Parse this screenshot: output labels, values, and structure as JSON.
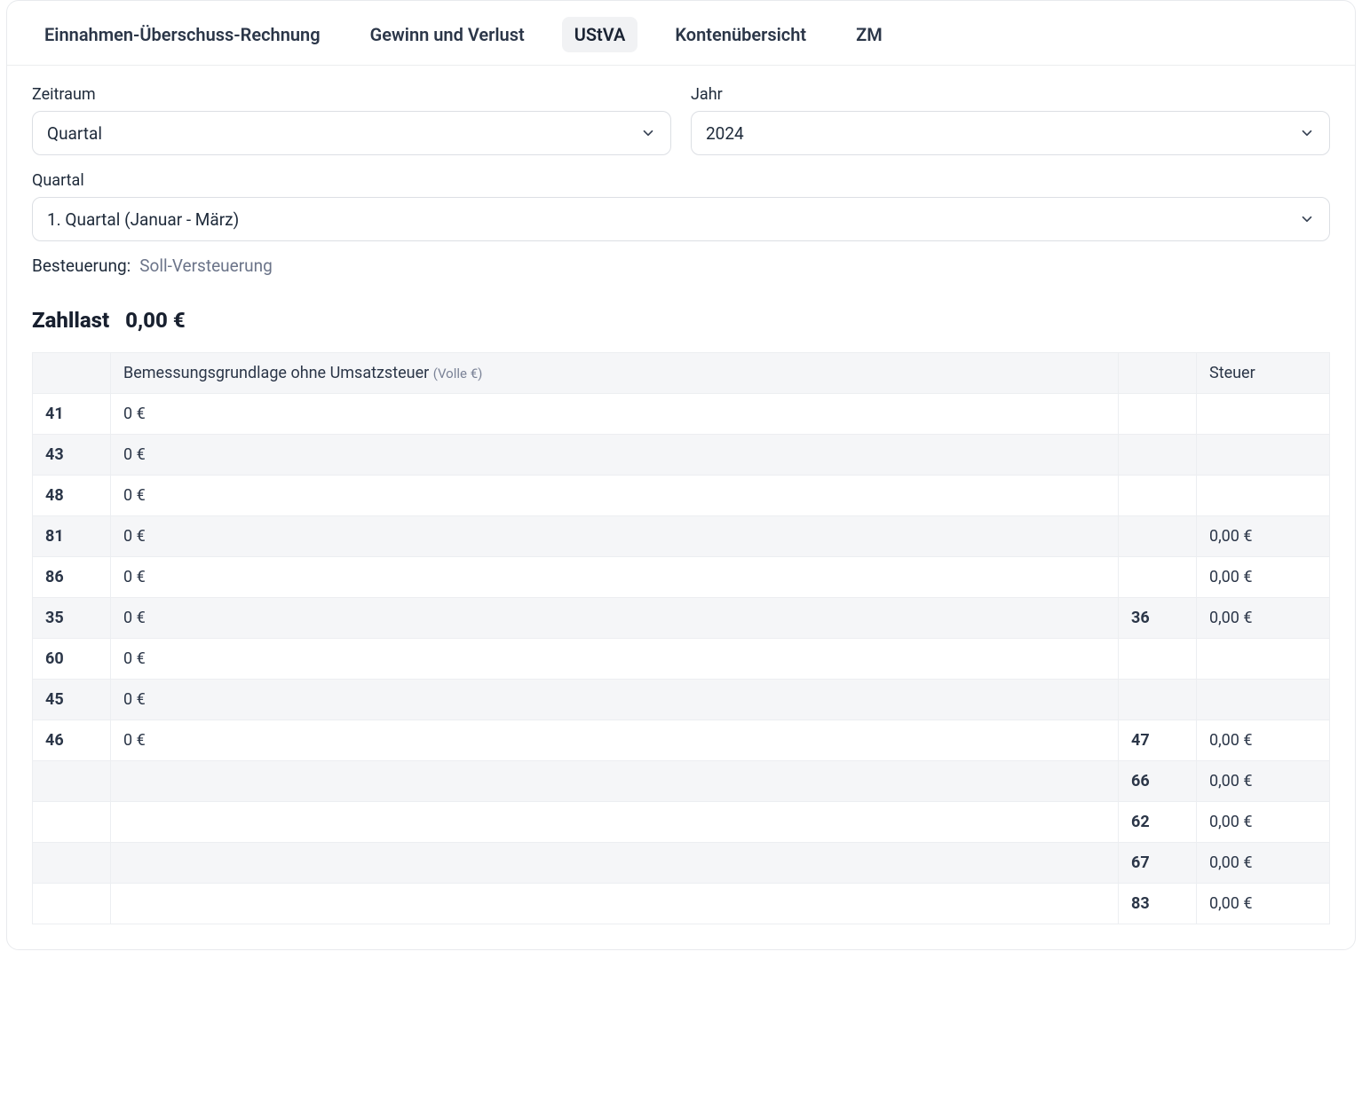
{
  "tabs": [
    {
      "label": "Einnahmen-Überschuss-Rechnung",
      "active": false
    },
    {
      "label": "Gewinn und Verlust",
      "active": false
    },
    {
      "label": "UStVA",
      "active": true
    },
    {
      "label": "Kontenübersicht",
      "active": false
    },
    {
      "label": "ZM",
      "active": false
    }
  ],
  "filters": {
    "zeitraum": {
      "label": "Zeitraum",
      "value": "Quartal"
    },
    "jahr": {
      "label": "Jahr",
      "value": "2024"
    },
    "quartal": {
      "label": "Quartal",
      "value": "1. Quartal (Januar - März)"
    }
  },
  "taxation": {
    "label": "Besteuerung:",
    "value": "Soll-Versteuerung"
  },
  "zahllast": {
    "label": "Zahllast",
    "value": "0,00 €"
  },
  "table": {
    "header": {
      "basis": "Bemessungsgrundlage ohne Umsatzsteuer ",
      "basis_hint": "(Volle €)",
      "steuer": "Steuer"
    },
    "rows": [
      {
        "code": "41",
        "basis": "0 €",
        "code2": "",
        "tax": ""
      },
      {
        "code": "43",
        "basis": "0 €",
        "code2": "",
        "tax": ""
      },
      {
        "code": "48",
        "basis": "0 €",
        "code2": "",
        "tax": ""
      },
      {
        "code": "81",
        "basis": "0 €",
        "code2": "",
        "tax": "0,00 €"
      },
      {
        "code": "86",
        "basis": "0 €",
        "code2": "",
        "tax": "0,00 €"
      },
      {
        "code": "35",
        "basis": "0 €",
        "code2": "36",
        "tax": "0,00 €"
      },
      {
        "code": "60",
        "basis": "0 €",
        "code2": "",
        "tax": ""
      },
      {
        "code": "45",
        "basis": "0 €",
        "code2": "",
        "tax": ""
      },
      {
        "code": "46",
        "basis": "0 €",
        "code2": "47",
        "tax": "0,00 €"
      },
      {
        "code": "",
        "basis": "",
        "code2": "66",
        "tax": "0,00 €"
      },
      {
        "code": "",
        "basis": "",
        "code2": "62",
        "tax": "0,00 €"
      },
      {
        "code": "",
        "basis": "",
        "code2": "67",
        "tax": "0,00 €"
      },
      {
        "code": "",
        "basis": "",
        "code2": "83",
        "tax": "0,00 €"
      }
    ]
  }
}
